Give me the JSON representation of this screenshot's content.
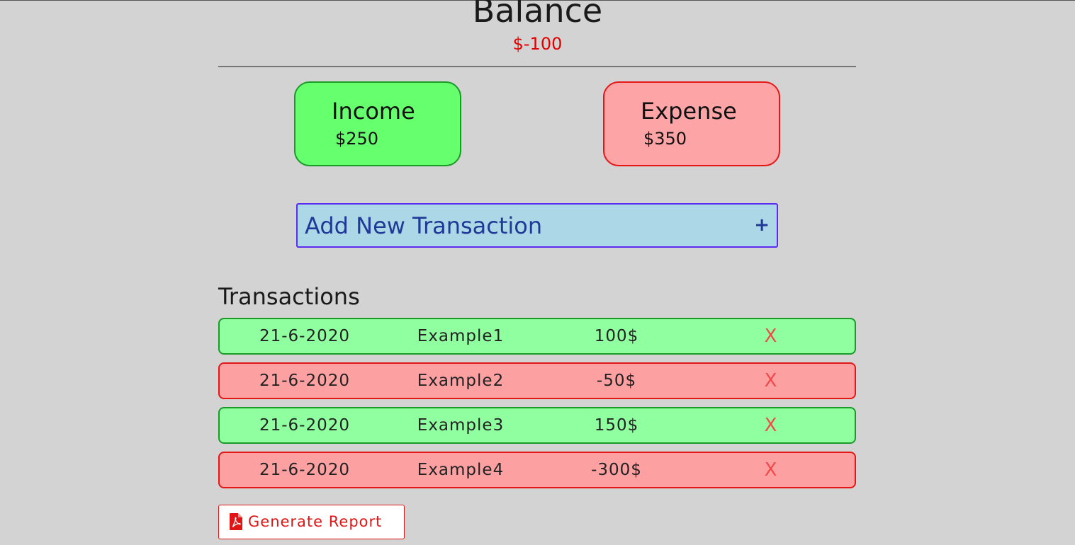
{
  "balance": {
    "title": "Balance",
    "value": "$-100"
  },
  "summary": {
    "income_label": "Income",
    "income_amount": "$250",
    "expense_label": "Expense",
    "expense_amount": "$350"
  },
  "add_transaction": {
    "label": "Add New Transaction",
    "icon_label": "+"
  },
  "transactions": {
    "heading": "Transactions",
    "rows": [
      {
        "date": "21-6-2020",
        "name": "Example1",
        "amount": "100$",
        "type": "income",
        "delete_label": "X"
      },
      {
        "date": "21-6-2020",
        "name": "Example2",
        "amount": "-50$",
        "type": "expense",
        "delete_label": "X"
      },
      {
        "date": "21-6-2020",
        "name": "Example3",
        "amount": "150$",
        "type": "income",
        "delete_label": "X"
      },
      {
        "date": "21-6-2020",
        "name": "Example4",
        "amount": "-300$",
        "type": "expense",
        "delete_label": "X"
      }
    ]
  },
  "report": {
    "label": "Generate Report",
    "icon": "pdf-icon"
  },
  "colors": {
    "background": "#d3d3d3",
    "balance_negative": "#e00000",
    "income_card": "#66ff6e",
    "expense_card": "#fda4a6",
    "income_row": "#8fff9f",
    "expense_row": "#fda0a2",
    "add_button": "#acd7e6",
    "delete_x": "#ef4b4b",
    "report_accent": "#e01515"
  }
}
